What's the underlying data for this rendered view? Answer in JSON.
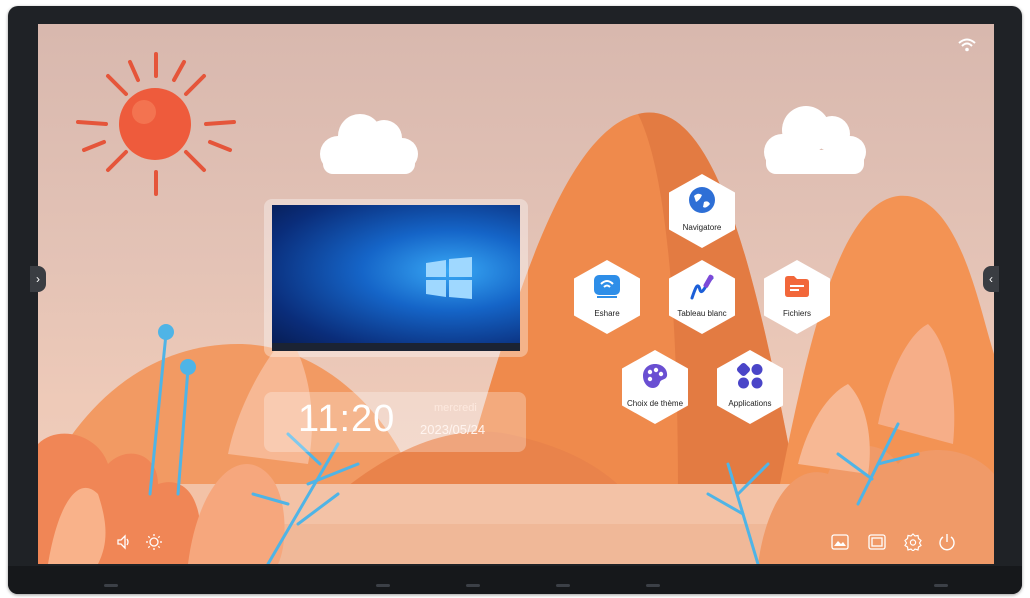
{
  "apps": [
    {
      "id": "navigatore",
      "label": "Navigatore",
      "icon": "globe-icon"
    },
    {
      "id": "eshare",
      "label": "Eshare",
      "icon": "screen-share-icon"
    },
    {
      "id": "tableau",
      "label": "Tableau blanc",
      "icon": "whiteboard-pen-icon"
    },
    {
      "id": "fichiers",
      "label": "Fichiers",
      "icon": "folder-icon"
    },
    {
      "id": "theme",
      "label": "Choix de thème",
      "icon": "palette-icon"
    },
    {
      "id": "applications",
      "label": "Applications",
      "icon": "apps-grid-icon"
    }
  ],
  "clock": {
    "time": "11:20",
    "day": "mercredi",
    "date": "2023/05/24"
  },
  "status": {
    "wifi_icon": "wifi-icon"
  },
  "bottom_left": [
    "volume-icon",
    "brightness-icon"
  ],
  "bottom_right": [
    "screenshot-icon",
    "window-icon",
    "settings-icon",
    "power-icon"
  ],
  "colors": {
    "accent": "#f08a4b",
    "hex_bg": "#ffffff",
    "desktop_blue": "#1565c8"
  }
}
